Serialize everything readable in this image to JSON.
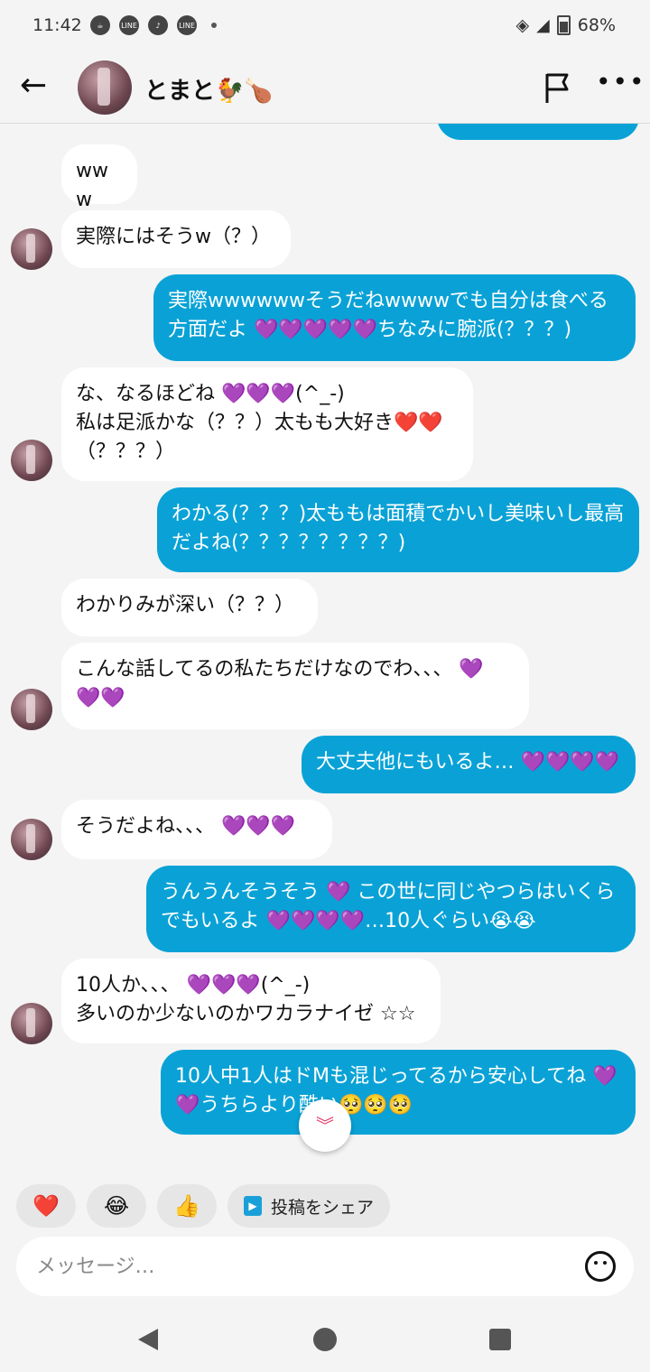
{
  "status": {
    "time": "11:42",
    "battery": "68%"
  },
  "header": {
    "title": "とまと🐓🍗"
  },
  "messages": [
    {
      "side": "in",
      "text": "www"
    },
    {
      "side": "in",
      "text": "実際にはそうw（？）"
    },
    {
      "side": "out",
      "text": "実際wwwwwwそうだねwwwwでも自分は食べる方面だよ 💜💜💜💜💜ちなみに腕派(？？？)"
    },
    {
      "side": "in",
      "text": "な、なるほどね 💜💜💜(^_-)\n私は足派かな（？？）太もも大好き❤️❤️\n（？？？）"
    },
    {
      "side": "out",
      "text": "わかる(？？？)太ももは面積でかいし美味いし最高だよね(？？？？？？？？)"
    },
    {
      "side": "in",
      "text": "わかりみが深い（？？）"
    },
    {
      "side": "in",
      "text": "こんな話してるの私たちだけなのでわ、、、 💜\n💜💜"
    },
    {
      "side": "out",
      "text": "大丈夫他にもいるよ… 💜💜💜💜"
    },
    {
      "side": "in",
      "text": "そうだよね、、、 💜💜💜"
    },
    {
      "side": "out",
      "text": "うんうんそうそう 💜 この世に同じやつらはいくらでもいるよ 💜💜💜💜…10人ぐらい😭😭"
    },
    {
      "side": "in",
      "text": "10人か、、、 💜💜💜(^_-)\n多いのか少ないのかワカラナイゼ ☆☆"
    },
    {
      "side": "out",
      "text": "10人中1人はドMも混じってるから安心してね 💜\n💜うちらより酷い🥺🥺🥺"
    }
  ],
  "reactions": [
    "❤️",
    "😂",
    "👍"
  ],
  "share_label": "投稿をシェア",
  "input": {
    "placeholder": "メッセージ…"
  }
}
